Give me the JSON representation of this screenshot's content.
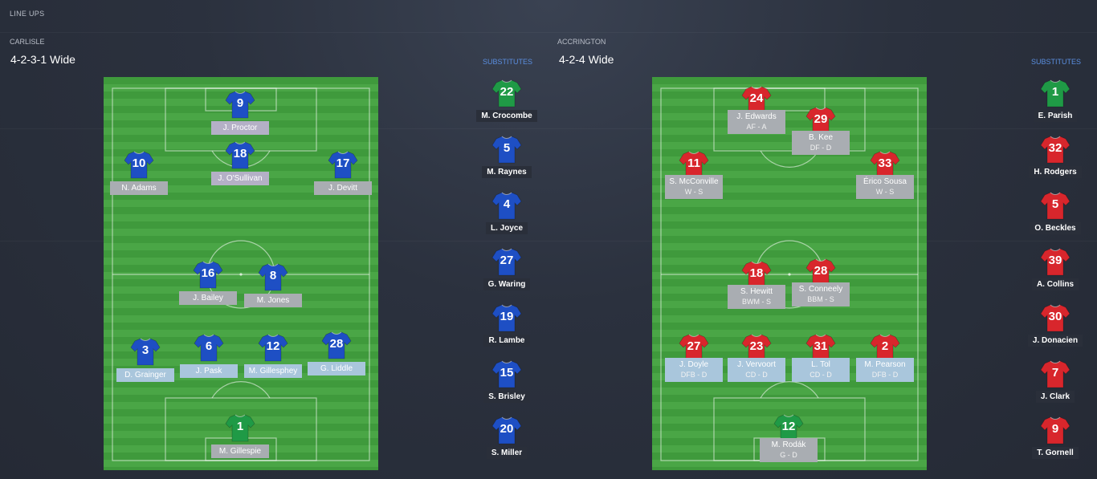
{
  "page": {
    "title": "LINE UPS"
  },
  "colors": {
    "home_shirt": "#1e4fc4",
    "away_shirt": "#d8262c",
    "gk_shirt": "#1f9a46",
    "pitch": "#3f9a3c"
  },
  "home": {
    "team": "CARLISLE",
    "formation": "4-2-3-1 Wide",
    "subs_label": "SUBSTITUTES",
    "players": [
      {
        "num": "9",
        "name": "J. Proctor",
        "role": ""
      },
      {
        "num": "18",
        "name": "J. O'Sullivan",
        "role": ""
      },
      {
        "num": "10",
        "name": "N. Adams",
        "role": ""
      },
      {
        "num": "17",
        "name": "J. Devitt",
        "role": ""
      },
      {
        "num": "16",
        "name": "J. Bailey",
        "role": ""
      },
      {
        "num": "8",
        "name": "M. Jones",
        "role": ""
      },
      {
        "num": "3",
        "name": "D. Grainger",
        "role": ""
      },
      {
        "num": "6",
        "name": "J. Pask",
        "role": ""
      },
      {
        "num": "12",
        "name": "M. Gillesphey",
        "role": ""
      },
      {
        "num": "28",
        "name": "G. Liddle",
        "role": ""
      },
      {
        "num": "1",
        "name": "M. Gillespie",
        "role": ""
      }
    ],
    "subs": [
      {
        "num": "22",
        "name": "M. Crocombe"
      },
      {
        "num": "5",
        "name": "M. Raynes"
      },
      {
        "num": "4",
        "name": "L. Joyce"
      },
      {
        "num": "27",
        "name": "G. Waring"
      },
      {
        "num": "19",
        "name": "R. Lambe"
      },
      {
        "num": "15",
        "name": "S. Brisley"
      },
      {
        "num": "20",
        "name": "S. Miller"
      }
    ]
  },
  "away": {
    "team": "ACCRINGTON",
    "formation": "4-2-4 Wide",
    "subs_label": "SUBSTITUTES",
    "players": [
      {
        "num": "24",
        "name": "J. Edwards",
        "role": "AF - A"
      },
      {
        "num": "29",
        "name": "B. Kee",
        "role": "DF - D"
      },
      {
        "num": "11",
        "name": "S. McConville",
        "role": "W - S"
      },
      {
        "num": "33",
        "name": "Érico Sousa",
        "role": "W - S"
      },
      {
        "num": "18",
        "name": "S. Hewitt",
        "role": "BWM - S"
      },
      {
        "num": "28",
        "name": "S. Conneely",
        "role": "BBM - S"
      },
      {
        "num": "27",
        "name": "J. Doyle",
        "role": "DFB - D"
      },
      {
        "num": "23",
        "name": "J. Vervoort",
        "role": "CD - D"
      },
      {
        "num": "31",
        "name": "L. Tol",
        "role": "CD - D"
      },
      {
        "num": "2",
        "name": "M. Pearson",
        "role": "DFB - D"
      },
      {
        "num": "12",
        "name": "M. Rodák",
        "role": "G - D"
      }
    ],
    "subs": [
      {
        "num": "1",
        "name": "E. Parish"
      },
      {
        "num": "32",
        "name": "H. Rodgers"
      },
      {
        "num": "5",
        "name": "O. Beckles"
      },
      {
        "num": "39",
        "name": "A. Collins"
      },
      {
        "num": "30",
        "name": "J. Donacien"
      },
      {
        "num": "7",
        "name": "J. Clark"
      },
      {
        "num": "9",
        "name": "T. Gornell"
      }
    ]
  }
}
